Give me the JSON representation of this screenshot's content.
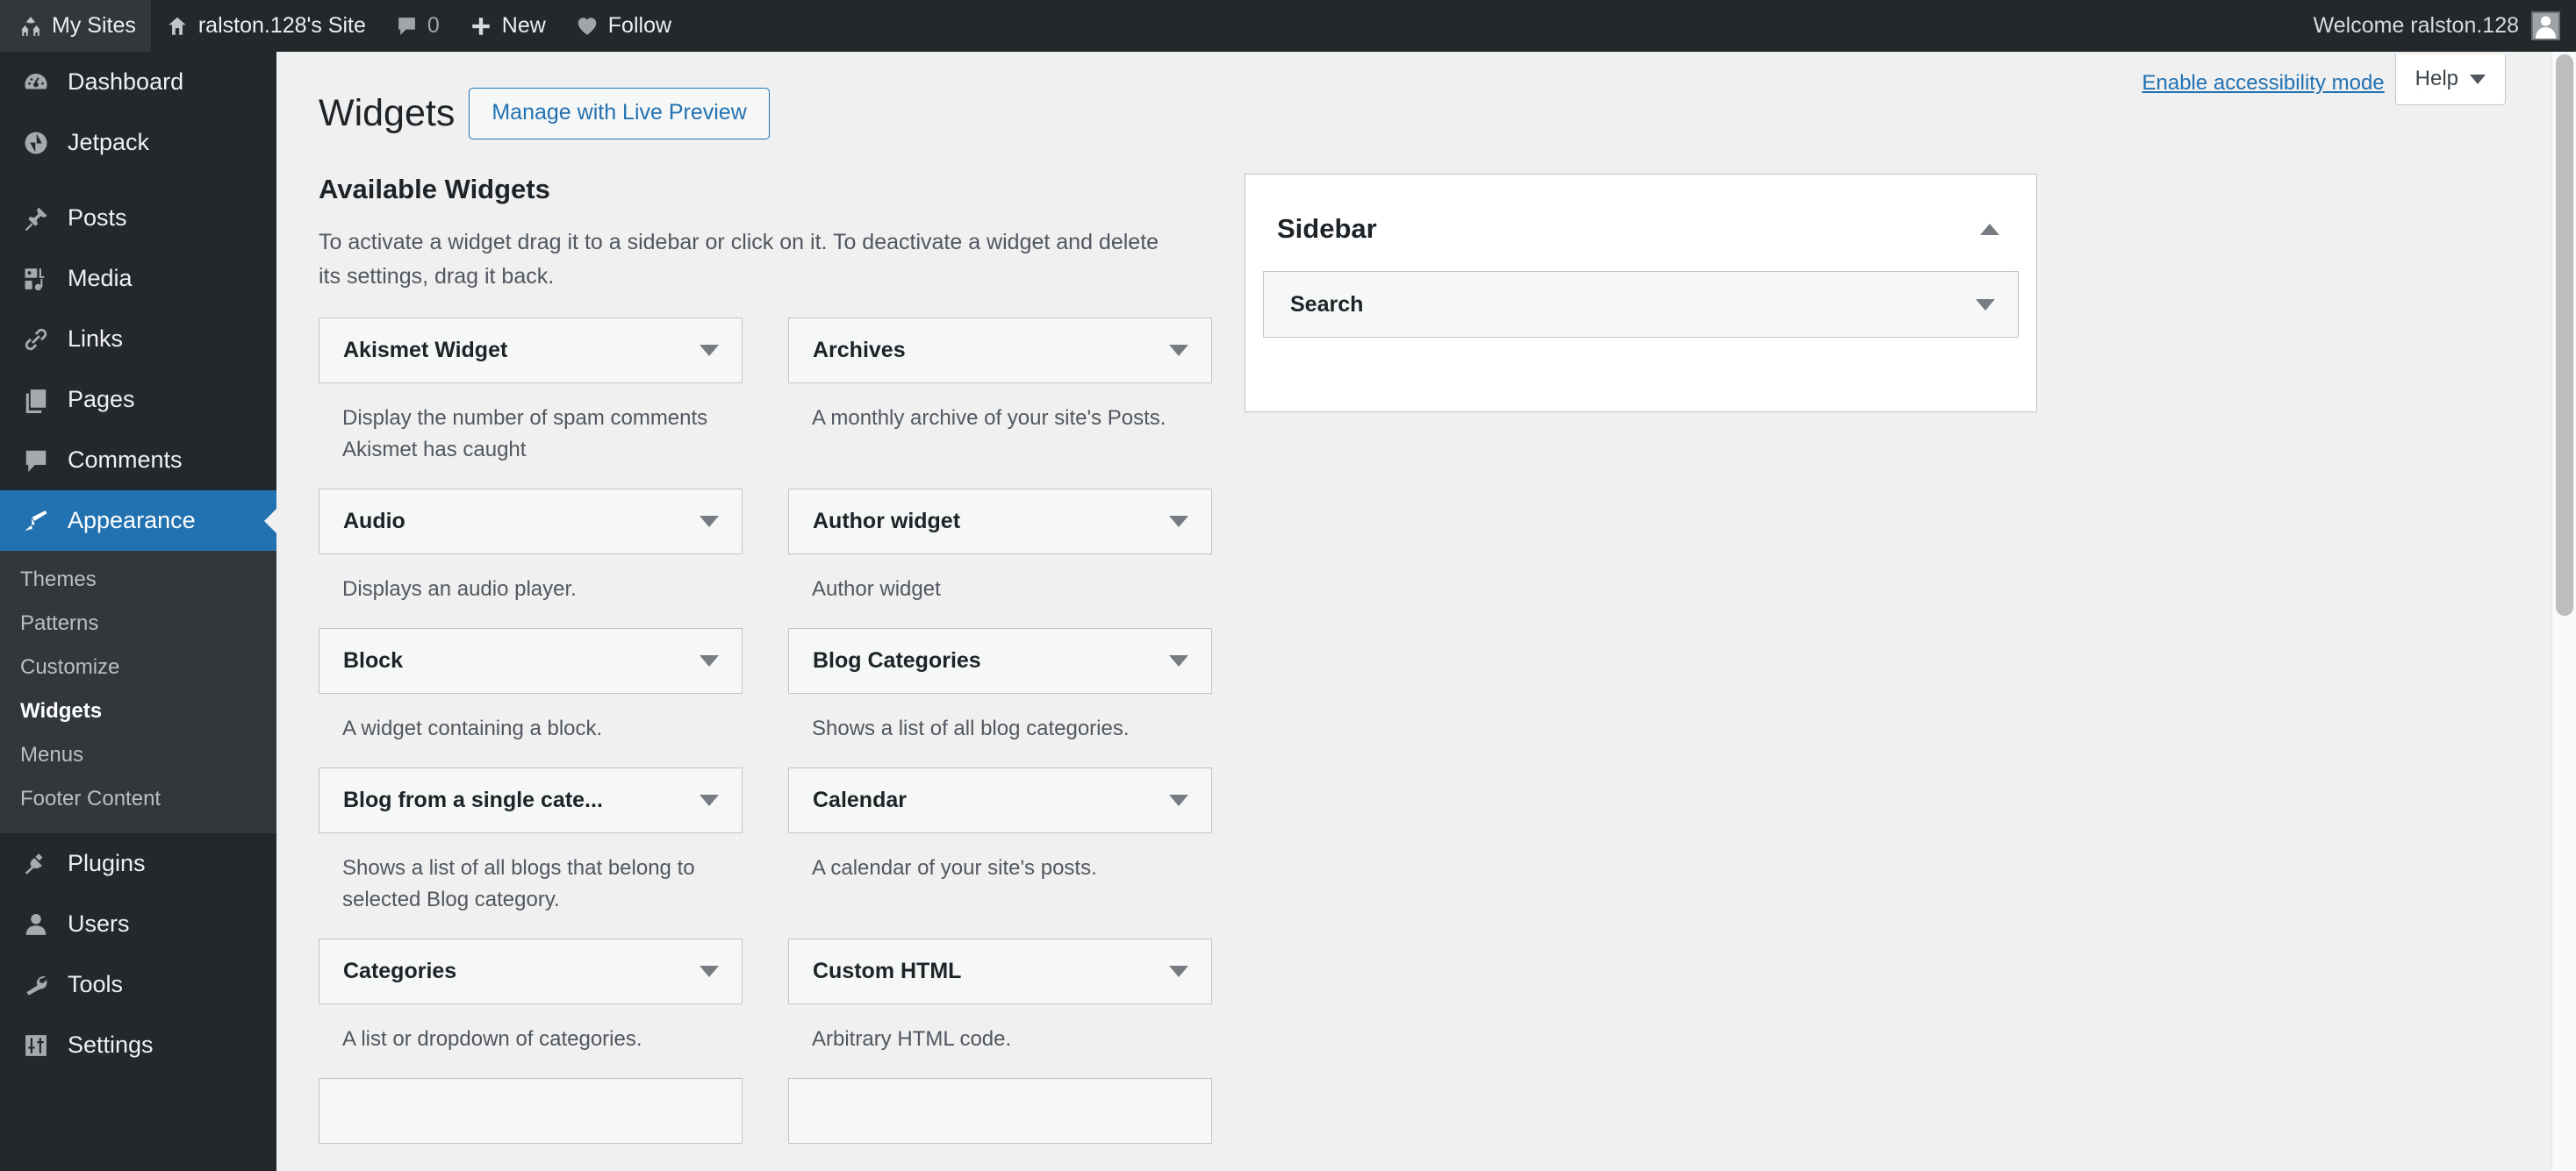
{
  "adminbar": {
    "items": [
      {
        "icon": "wordpress-sites-icon",
        "label": "My Sites"
      },
      {
        "icon": "home-icon",
        "label": "ralston.128's Site"
      },
      {
        "icon": "comment-icon",
        "label": "0"
      },
      {
        "icon": "plus-icon",
        "label": "New"
      },
      {
        "icon": "heart-icon",
        "label": "Follow"
      }
    ],
    "my_sites_label": "My Sites",
    "site_label": "ralston.128's Site",
    "comment_count": "0",
    "new_label": "New",
    "follow_label": "Follow",
    "welcome_label": "Welcome ralston.128"
  },
  "adminmenu": {
    "items": [
      {
        "label": "Dashboard",
        "icon": "dashboard-icon",
        "current": false
      },
      {
        "label": "Jetpack",
        "icon": "jetpack-icon",
        "current": false
      },
      {
        "label": "Posts",
        "icon": "pin-icon",
        "current": false
      },
      {
        "label": "Media",
        "icon": "media-icon",
        "current": false
      },
      {
        "label": "Links",
        "icon": "link-icon",
        "current": false
      },
      {
        "label": "Pages",
        "icon": "pages-icon",
        "current": false
      },
      {
        "label": "Comments",
        "icon": "comments-icon",
        "current": false
      },
      {
        "label": "Appearance",
        "icon": "appearance-brush-icon",
        "current": true
      }
    ],
    "appearance_submenu": [
      {
        "label": "Themes",
        "current": false
      },
      {
        "label": "Patterns",
        "current": false
      },
      {
        "label": "Customize",
        "current": false
      },
      {
        "label": "Widgets",
        "current": true
      },
      {
        "label": "Menus",
        "current": false
      },
      {
        "label": "Footer Content",
        "current": false
      }
    ],
    "items_after": [
      {
        "label": "Plugins",
        "icon": "plug-icon"
      },
      {
        "label": "Users",
        "icon": "user-icon"
      },
      {
        "label": "Tools",
        "icon": "wrench-icon"
      },
      {
        "label": "Settings",
        "icon": "settings-sliders-icon"
      }
    ]
  },
  "screen_meta": {
    "accessibility_link": "Enable accessibility mode",
    "help_label": "Help"
  },
  "page": {
    "title": "Widgets",
    "live_preview_button": "Manage with Live Preview",
    "available_heading": "Available Widgets",
    "available_description": "To activate a widget drag it to a sidebar or click on it. To deactivate a widget and delete its settings, drag it back."
  },
  "available_widgets": [
    {
      "title": "Akismet Widget",
      "description": "Display the number of spam comments Akismet has caught"
    },
    {
      "title": "Archives",
      "description": "A monthly archive of your site's Posts."
    },
    {
      "title": "Audio",
      "description": "Displays an audio player."
    },
    {
      "title": "Author widget",
      "description": "Author widget"
    },
    {
      "title": "Block",
      "description": "A widget containing a block."
    },
    {
      "title": "Blog Categories",
      "description": "Shows a list of all blog categories."
    },
    {
      "title": "Blog from a single cate...",
      "description": "Shows a list of all blogs that belong to selected Blog category."
    },
    {
      "title": "Calendar",
      "description": "A calendar of your site's posts."
    },
    {
      "title": "Categories",
      "description": "A list or dropdown of categories."
    },
    {
      "title": "Custom HTML",
      "description": "Arbitrary HTML code."
    },
    {
      "title": "",
      "description": ""
    },
    {
      "title": "",
      "description": ""
    }
  ],
  "sidebar_panel": {
    "title": "Sidebar",
    "toggle_icon": "chevron-up-icon",
    "widgets": [
      {
        "title": "Search",
        "toggle_icon": "chevron-down-icon"
      }
    ]
  },
  "colors": {
    "admin_bar_bg": "#23282d",
    "menu_bg": "#23282d",
    "submenu_bg": "#32373c",
    "current_menu_bg": "#2271b1",
    "content_bg": "#f0f0f1",
    "link_blue": "#2271b1",
    "widget_box_bg": "#f6f7f7",
    "border_gray": "#c3c4c7"
  }
}
